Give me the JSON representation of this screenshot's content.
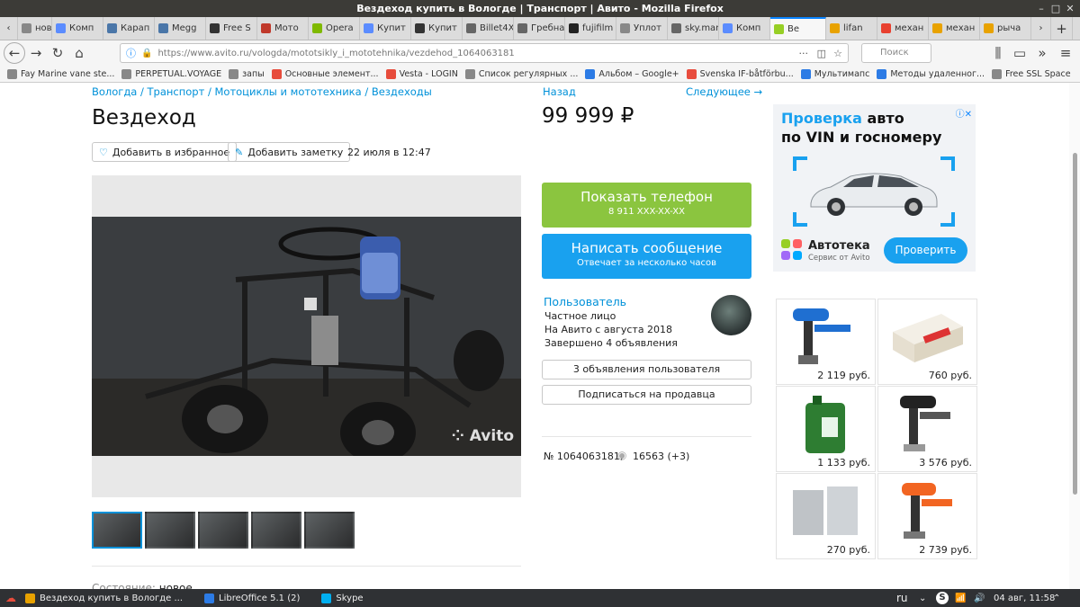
{
  "window": {
    "title": "Вездеход купить в Вологде | Транспорт | Авито - Mozilla Firefox"
  },
  "tabs": [
    {
      "label": "нов",
      "color": "#888"
    },
    {
      "label": "Комп",
      "color": "#5b8cff"
    },
    {
      "label": "Карап",
      "color": "#4a76a8"
    },
    {
      "label": "Megg",
      "color": "#4a76a8"
    },
    {
      "label": "Free S",
      "color": "#333"
    },
    {
      "label": "Мото",
      "color": "#c0392b"
    },
    {
      "label": "Opera",
      "color": "#7fb900"
    },
    {
      "label": "Купит",
      "color": "#5b8cff"
    },
    {
      "label": "Купит",
      "color": "#333"
    },
    {
      "label": "Billet4X4",
      "color": "#666"
    },
    {
      "label": "Гребная",
      "color": "#666"
    },
    {
      "label": "fujifilm",
      "color": "#222"
    },
    {
      "label": "Уплот",
      "color": "#888"
    },
    {
      "label": "sky.mana",
      "color": "#666"
    },
    {
      "label": "Комп",
      "color": "#5b8cff"
    },
    {
      "label": "Ве",
      "color": "#97cf26",
      "active": true
    },
    {
      "label": "lifan",
      "color": "#e8a200"
    },
    {
      "label": "механ",
      "color": "#e8402f"
    },
    {
      "label": "механ",
      "color": "#e8a200"
    },
    {
      "label": "рыча",
      "color": "#e8a200"
    }
  ],
  "nav": {
    "url": "https://www.avito.ru/vologda/mototsikly_i_mototehnika/vezdehod_1064063181",
    "search_placeholder": "Поиск"
  },
  "bookmarks": [
    {
      "label": "Fay Marine vane ste..."
    },
    {
      "label": "PERPETUAL.VOYAGE"
    },
    {
      "label": "запы"
    },
    {
      "label": "Основные элемент..."
    },
    {
      "label": "Vesta - LOGIN"
    },
    {
      "label": "Список регулярных ..."
    },
    {
      "label": "Альбом – Google+"
    },
    {
      "label": "Svenska IF-båtförbu..."
    },
    {
      "label": "Мультимапс"
    },
    {
      "label": "Методы удаленног..."
    },
    {
      "label": "Free SSL Space"
    }
  ],
  "listing": {
    "breadcrumb": "Вологда / Транспорт / Мотоциклы и мототехника / Вездеходы",
    "title": "Вездеход",
    "fav_btn": "Добавить в избранное",
    "note_btn": "Добавить заметку",
    "date": "22 июля в 12:47",
    "watermark": "Avito",
    "condition_label": "Состояние:",
    "condition_value": "новое"
  },
  "sidebar": {
    "back": "Назад",
    "next": "Следующее →",
    "price": "99 999 ₽",
    "phone_btn": "Показать телефон",
    "phone_number": "8 911 XXX-XX-XX",
    "msg_btn": "Написать сообщение",
    "msg_sub": "Отвечает за несколько часов",
    "seller_name": "Пользователь",
    "seller_type": "Частное лицо",
    "seller_since": "На Авито с августа 2018",
    "seller_done": "Завершено 4 объявления",
    "listings_btn": "3 объявления пользователя",
    "subscribe_btn": "Подписаться на продавца",
    "ad_id": "№ 1064063181,",
    "views": "16563 (+3)"
  },
  "ad_banner": {
    "headline_1": "Проверка",
    "headline_2": "авто",
    "headline_3": "по VIN",
    "headline_4": "и госномеру",
    "brand": "Автотека",
    "brand_sub": "Сервис от Avito",
    "cta": "Проверить"
  },
  "goods": [
    {
      "price": "2 119 руб."
    },
    {
      "price": "760 руб."
    },
    {
      "price": "1 133 руб."
    },
    {
      "price": "3 576 руб."
    },
    {
      "price": "270 руб."
    },
    {
      "price": "2 739 руб."
    }
  ],
  "taskbar": {
    "items": [
      {
        "label": "Вездеход купить в Вологде ..."
      },
      {
        "label": "LibreOffice 5.1 (2)"
      },
      {
        "label": "Skype"
      }
    ],
    "lang": "ru",
    "clock": "04 авг, 11:58"
  }
}
